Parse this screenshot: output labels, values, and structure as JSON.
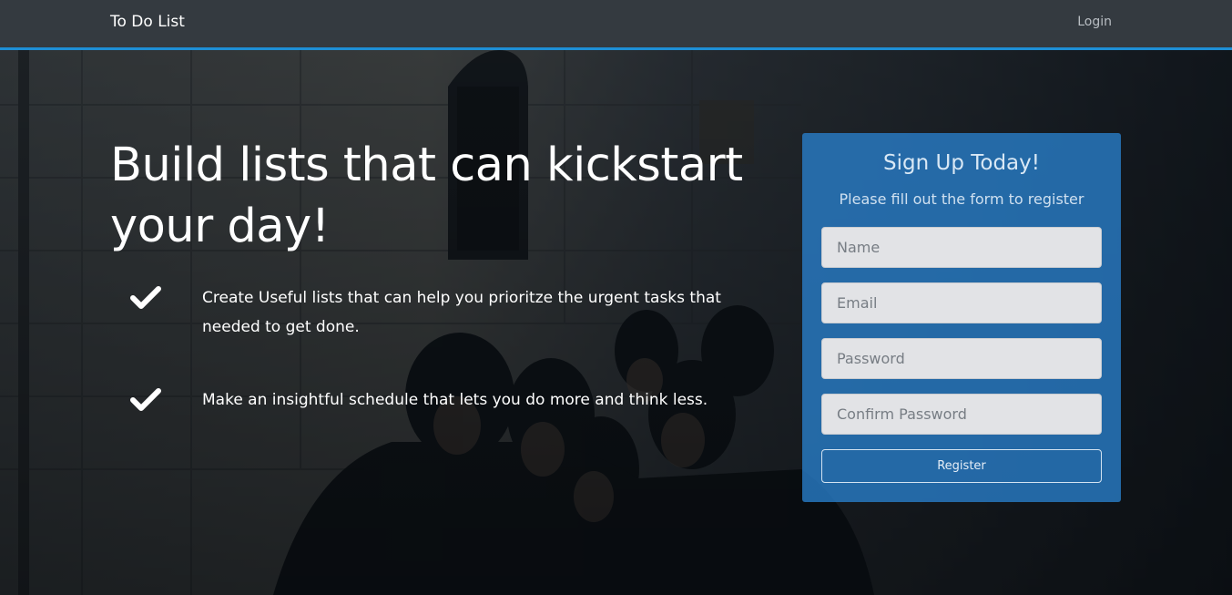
{
  "navbar": {
    "brand": "To Do List",
    "login_label": "Login"
  },
  "hero": {
    "headline": "Build lists that can kickstart your day!",
    "features": [
      {
        "icon": "checkmark-icon",
        "text": "Create Useful lists that can help you prioritze the urgent tasks that needed to get done."
      },
      {
        "icon": "checkmark-icon",
        "text": "Make an insightful schedule that lets you do more and think less."
      }
    ]
  },
  "signup": {
    "title": "Sign Up Today!",
    "subtitle": "Please fill out the form to register",
    "fields": {
      "name": {
        "placeholder": "Name",
        "value": ""
      },
      "email": {
        "placeholder": "Email",
        "value": ""
      },
      "password": {
        "placeholder": "Password",
        "value": ""
      },
      "confirm_password": {
        "placeholder": "Confirm Password",
        "value": ""
      }
    },
    "register_label": "Register"
  },
  "colors": {
    "navbar_bg": "#343a40",
    "navbar_accent": "#1e8fd6",
    "signup_panel": "#2980cd"
  }
}
